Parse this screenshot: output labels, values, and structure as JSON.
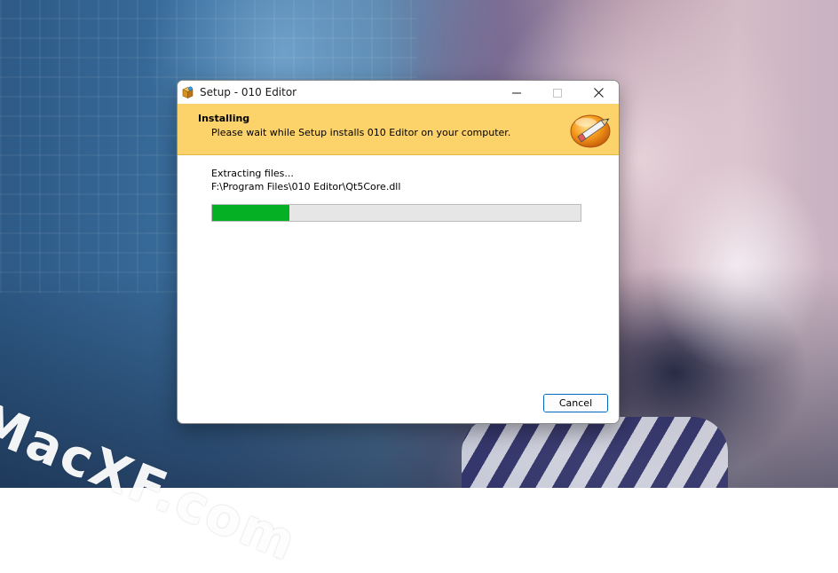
{
  "window": {
    "title": "Setup - 010 Editor",
    "icon": "installer-box-icon"
  },
  "window_controls": {
    "minimize_icon": "minimize-icon",
    "maximize_icon": "maximize-icon",
    "close_icon": "close-icon"
  },
  "header": {
    "title": "Installing",
    "subtitle": "Please wait while Setup installs 010 Editor on your computer.",
    "logo_icon": "pencil-edit-icon",
    "background_color": "#fcd26a"
  },
  "progress": {
    "status": "Extracting files...",
    "current_file": "F:\\Program Files\\010 Editor\\Qt5Core.dll",
    "fraction": 0.21,
    "fill_color": "#06b025"
  },
  "buttons": {
    "cancel": "Cancel"
  },
  "watermark": {
    "text": "MacXF.com"
  }
}
